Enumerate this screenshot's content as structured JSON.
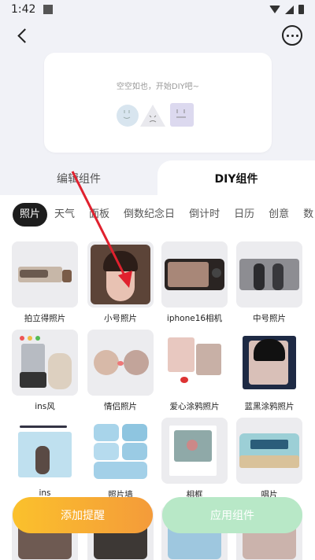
{
  "status": {
    "time": "1:42"
  },
  "preview": {
    "empty_text": "空空如也，开始DIY吧~"
  },
  "tabs": {
    "edit_label": "编辑组件",
    "diy_label": "DIY组件"
  },
  "categories": [
    "照片",
    "天气",
    "面板",
    "倒数纪念日",
    "倒计时",
    "日历",
    "创意",
    "数"
  ],
  "active_category": "照片",
  "widgets": [
    {
      "label": "拍立得照片"
    },
    {
      "label": "小号照片"
    },
    {
      "label": "iphone16相机"
    },
    {
      "label": "中号照片"
    },
    {
      "label": "ins风"
    },
    {
      "label": "情侣照片"
    },
    {
      "label": "爱心涂鸦照片"
    },
    {
      "label": "蓝黑涂鸦照片"
    },
    {
      "label": "ins"
    },
    {
      "label": "照片墙"
    },
    {
      "label": "相框"
    },
    {
      "label": "唱片"
    }
  ],
  "buttons": {
    "add_reminder": "添加提醒",
    "apply_widget": "应用组件"
  },
  "colors": {
    "accent_yellow": "#fbc12c",
    "accent_orange": "#f49b3a",
    "apply_green": "#b8e8c7",
    "annotation_red": "#e0212e"
  }
}
